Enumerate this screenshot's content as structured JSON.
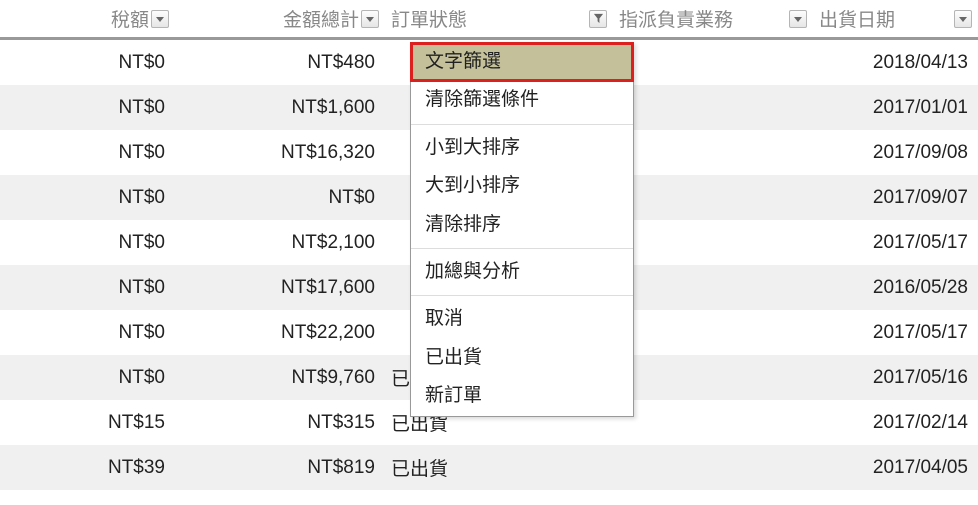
{
  "columns": {
    "tax": "稅額",
    "total": "金額總計",
    "status": "訂單狀態",
    "assignee": "指派負責業務",
    "shipdate": "出貨日期"
  },
  "rows": [
    {
      "tax": "NT$0",
      "total": "NT$480",
      "status": "",
      "shipdate": "2018/04/13"
    },
    {
      "tax": "NT$0",
      "total": "NT$1,600",
      "status": "",
      "shipdate": "2017/01/01"
    },
    {
      "tax": "NT$0",
      "total": "NT$16,320",
      "status": "",
      "shipdate": "2017/09/08"
    },
    {
      "tax": "NT$0",
      "total": "NT$0",
      "status": "",
      "shipdate": "2017/09/07"
    },
    {
      "tax": "NT$0",
      "total": "NT$2,100",
      "status": "",
      "shipdate": "2017/05/17"
    },
    {
      "tax": "NT$0",
      "total": "NT$17,600",
      "status": "",
      "shipdate": "2016/05/28"
    },
    {
      "tax": "NT$0",
      "total": "NT$22,200",
      "status": "",
      "shipdate": "2017/05/17"
    },
    {
      "tax": "NT$0",
      "total": "NT$9,760",
      "status": "已出貨",
      "shipdate": "2017/05/16"
    },
    {
      "tax": "NT$15",
      "total": "NT$315",
      "status": "已出貨",
      "shipdate": "2017/02/14"
    },
    {
      "tax": "NT$39",
      "total": "NT$819",
      "status": "已出貨",
      "shipdate": "2017/04/05"
    }
  ],
  "dropdown": {
    "groups": [
      [
        "文字篩選",
        "清除篩選條件"
      ],
      [
        "小到大排序",
        "大到小排序",
        "清除排序"
      ],
      [
        "加總與分析"
      ],
      [
        "取消",
        "已出貨",
        "新訂單"
      ]
    ],
    "highlighted": "文字篩選"
  }
}
